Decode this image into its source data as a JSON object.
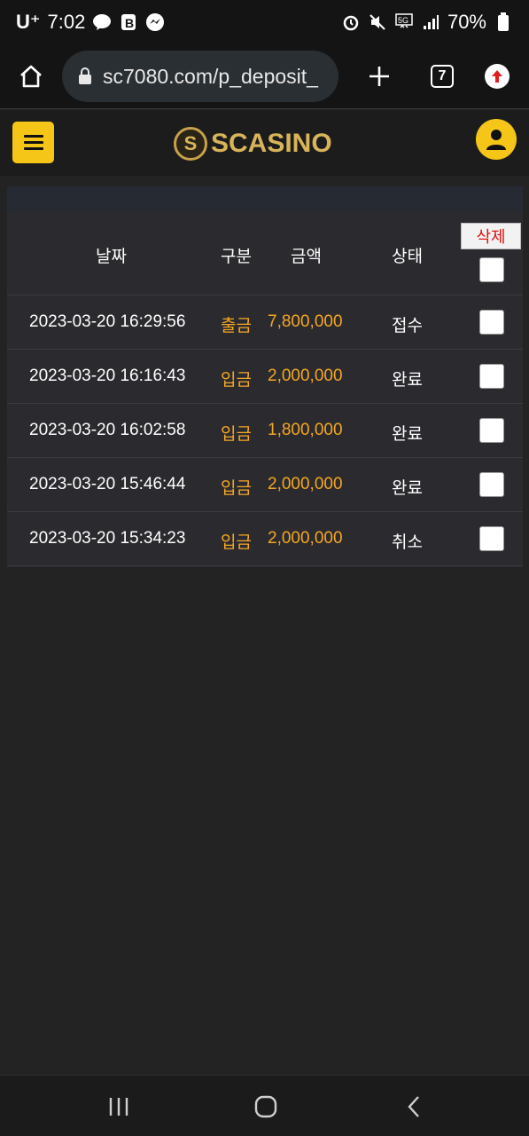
{
  "status_bar": {
    "carrier": "U⁺",
    "time": "7:02",
    "battery": "70%",
    "icons": [
      "talk-icon",
      "b-icon",
      "messenger-icon",
      "alarm-icon",
      "mute-icon",
      "5g-icon",
      "signal-icon",
      "battery-icon"
    ]
  },
  "browser": {
    "url": "sc7080.com/p_deposit_",
    "tab_count": "7",
    "icons": [
      "home-icon",
      "lock-icon",
      "plus-icon",
      "tabs-icon",
      "update-icon"
    ]
  },
  "site": {
    "logo_text": "SCASINO",
    "logo_mark": "S",
    "colors": {
      "accent": "#f5c518",
      "amount": "#f5a623",
      "background": "#232323",
      "panel": "#2b2b2f",
      "delete_text": "#dd1111"
    }
  },
  "table": {
    "headers": {
      "date": "날짜",
      "type": "구분",
      "amount": "금액",
      "status": "상태"
    },
    "delete_label": "삭제",
    "rows": [
      {
        "date": "2023-03-20 16:29:56",
        "type": "출금",
        "amount": "7,800,000",
        "status": "접수"
      },
      {
        "date": "2023-03-20 16:16:43",
        "type": "입금",
        "amount": "2,000,000",
        "status": "완료"
      },
      {
        "date": "2023-03-20 16:02:58",
        "type": "입금",
        "amount": "1,800,000",
        "status": "완료"
      },
      {
        "date": "2023-03-20 15:46:44",
        "type": "입금",
        "amount": "2,000,000",
        "status": "완료"
      },
      {
        "date": "2023-03-20 15:34:23",
        "type": "입금",
        "amount": "2,000,000",
        "status": "취소"
      }
    ]
  },
  "nav": {
    "icons": [
      "recent-apps-icon",
      "home-circle-icon",
      "back-icon"
    ]
  }
}
